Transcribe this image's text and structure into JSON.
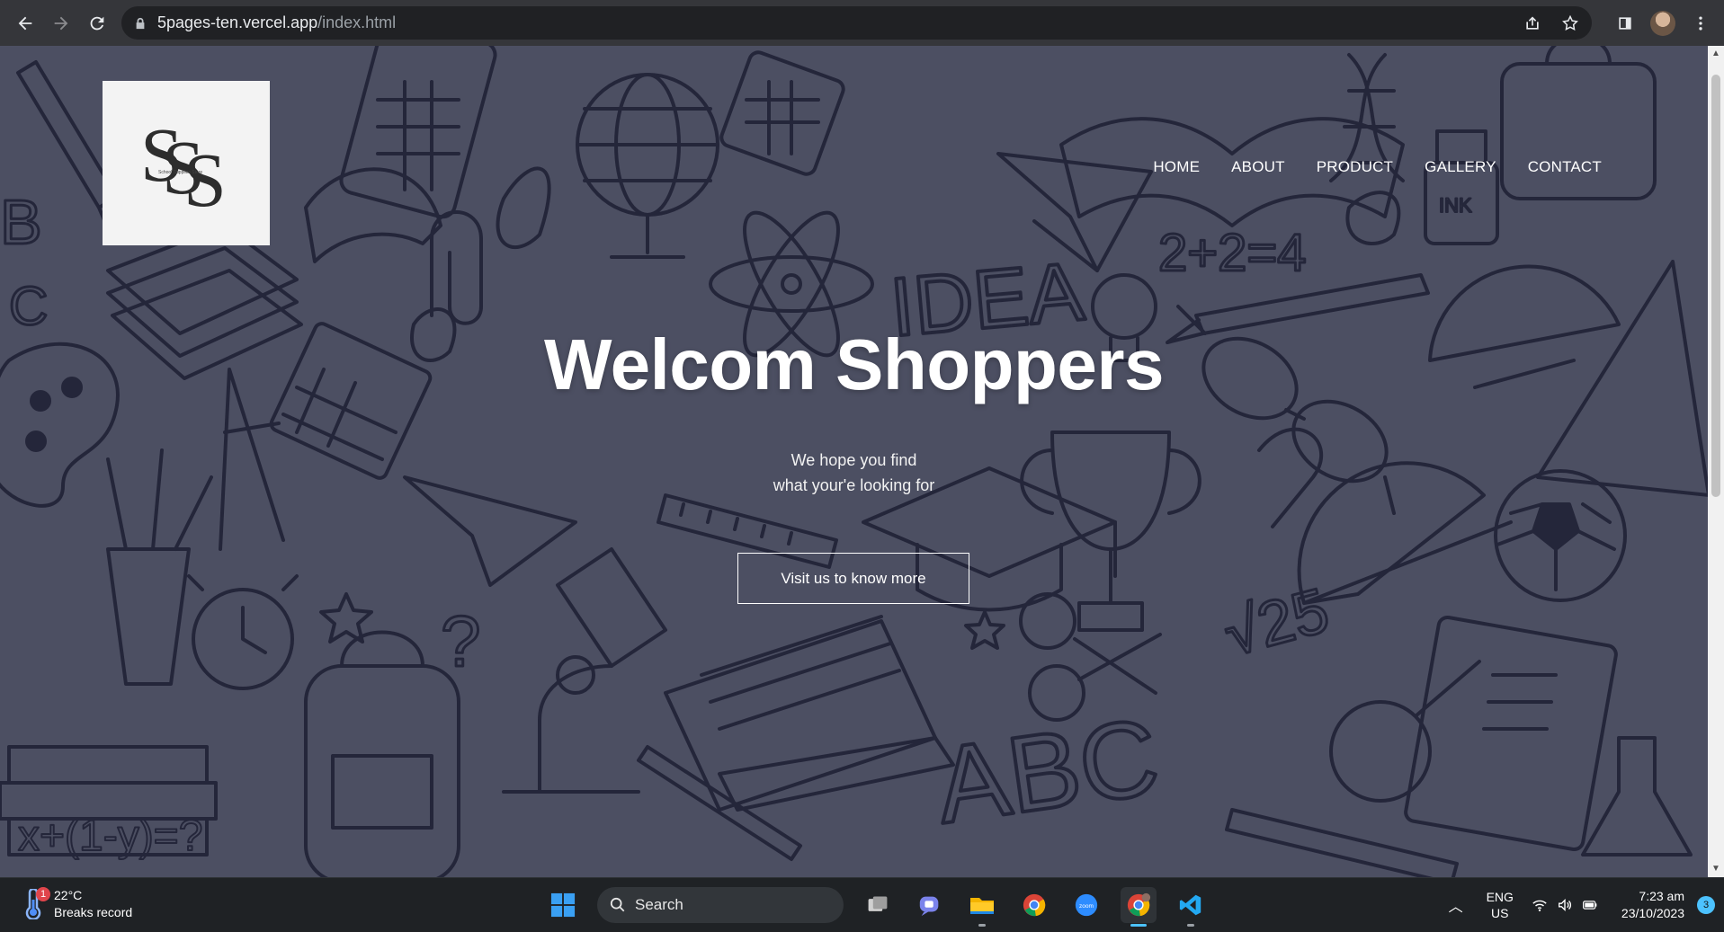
{
  "browser": {
    "url_host": "5pages-ten.vercel.app",
    "url_path": "/index.html"
  },
  "site": {
    "logo_letters": "SSS",
    "logo_small_text": "School Supplies Store",
    "nav": [
      "HOME",
      "ABOUT",
      "PRODUCT",
      "GALLERY",
      "CONTACT"
    ],
    "hero_title": "Welcom Shoppers",
    "hero_sub_line1": "We hope you find",
    "hero_sub_line2": "what your'e looking for",
    "hero_button": "Visit us to know more",
    "background_doodles": "IDEA"
  },
  "taskbar": {
    "weather_temp": "22°C",
    "weather_desc": "Breaks record",
    "weather_badge": "1",
    "search_label": "Search",
    "lang_line1": "ENG",
    "lang_line2": "US",
    "time": "7:23 am",
    "date": "23/10/2023",
    "notification_count": "3"
  },
  "colors": {
    "page_bg": "#4e5163",
    "doodle_stroke": "#1d1f33",
    "chrome_bg": "#35363a",
    "taskbar_bg": "#1f2225"
  }
}
